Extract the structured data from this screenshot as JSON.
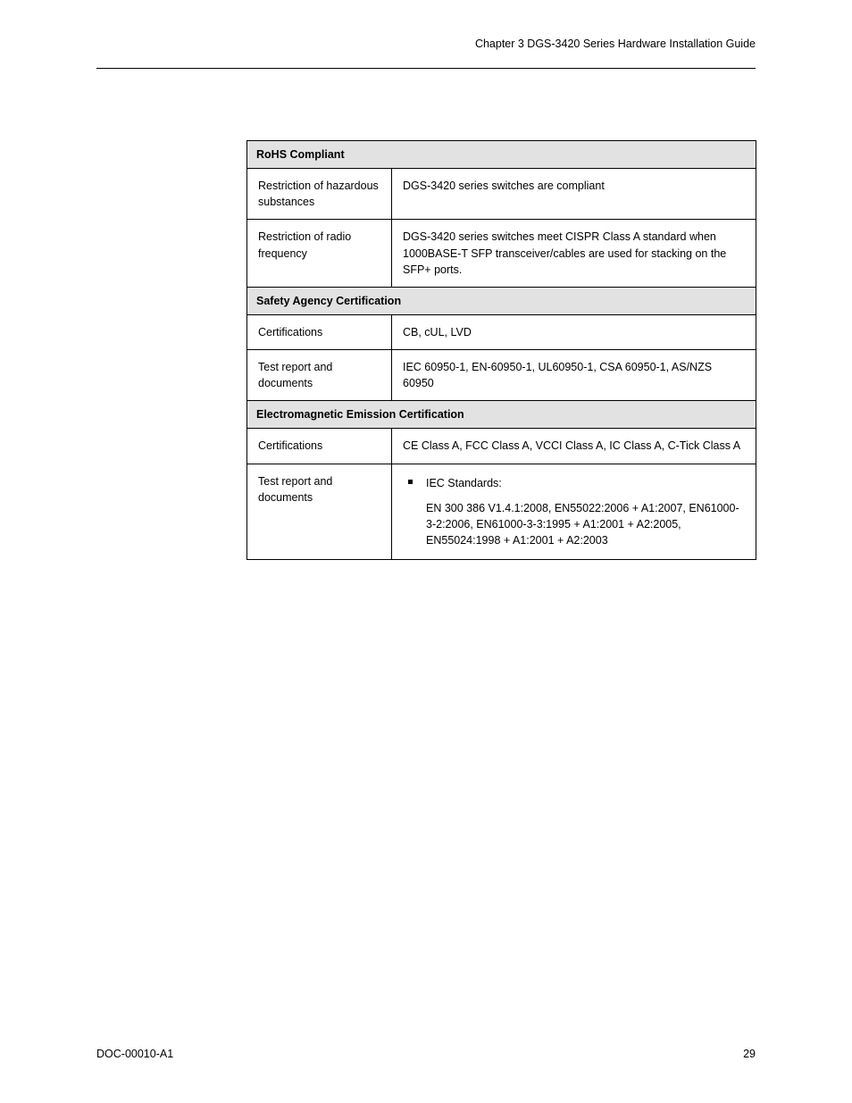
{
  "header": {
    "running_title": "Chapter 3 DGS-3420 Series Hardware Installation Guide"
  },
  "table": {
    "sections": [
      {
        "title": "RoHS Compliant",
        "rows": [
          {
            "label": "Restriction of hazardous substances",
            "value": "DGS-3420 series switches are compliant"
          },
          {
            "label": "Restriction of radio frequency",
            "value": "DGS-3420 series switches meet CISPR Class A standard when 1000BASE-T SFP transceiver/cables are used for stacking on the SFP+ ports."
          }
        ]
      },
      {
        "title": "Safety Agency Certification",
        "rows": [
          {
            "label": "Certifications",
            "value": "CB, cUL, LVD"
          },
          {
            "label": "Test report and documents",
            "value": "IEC 60950-1, EN-60950-1, UL60950-1, CSA 60950-1, AS/NZS 60950"
          }
        ]
      },
      {
        "title": "Electromagnetic Emission Certification",
        "rows": [
          {
            "label": "Certifications",
            "value": "CE Class A, FCC Class A, VCCI Class A, IC Class A, C-Tick Class A"
          },
          {
            "label": "Test report and documents",
            "bullets": [
              {
                "main": "IEC Standards:",
                "sub": "EN 300 386 V1.4.1:2008, EN55022:2006 + A1:2007, EN61000-3-2:2006, EN61000-3-3:1995 + A1:2001 + A2:2005, EN55024:1998 + A1:2001 + A2:2003"
              }
            ]
          }
        ]
      }
    ]
  },
  "footer": {
    "page_number": "29",
    "version": "DOC-00010-A1"
  }
}
